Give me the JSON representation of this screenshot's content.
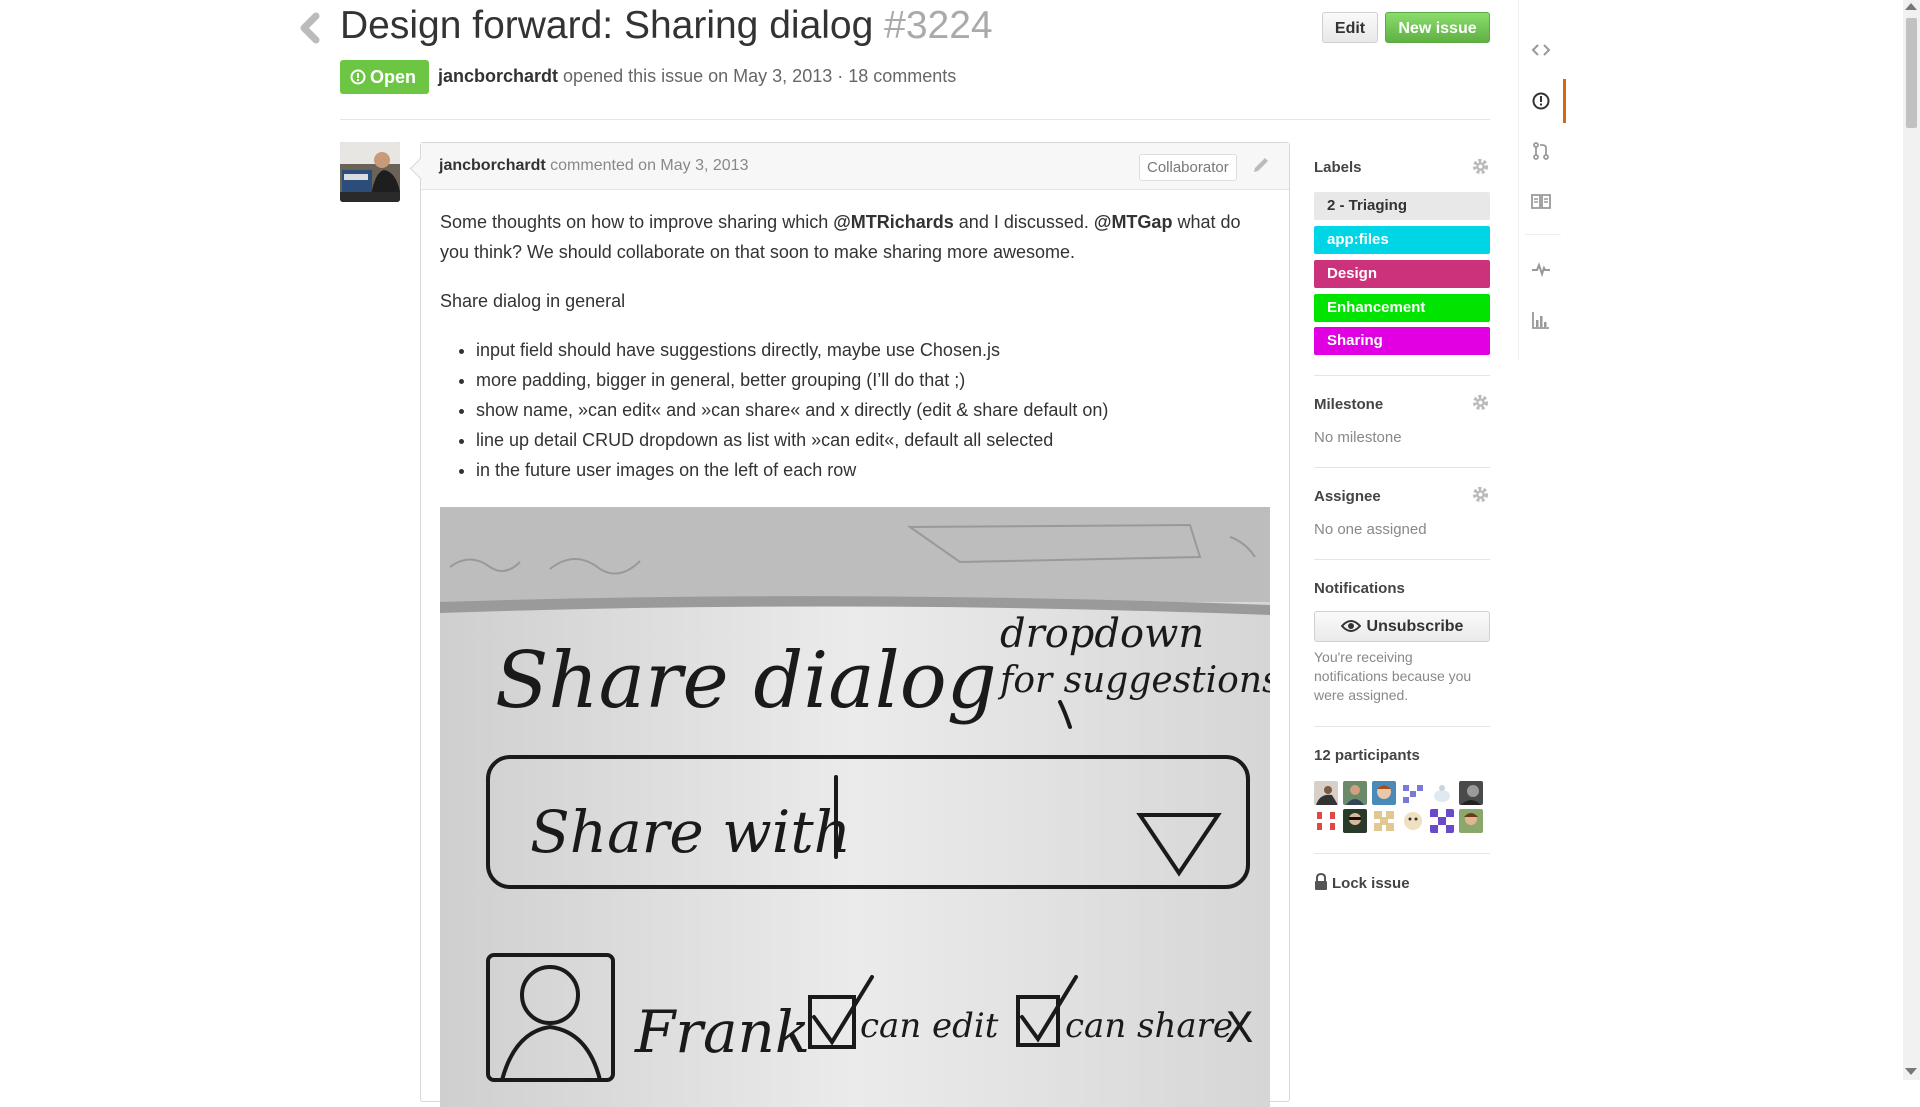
{
  "issue": {
    "title": "Design forward: Sharing dialog",
    "number": "#3224",
    "state": "Open",
    "author": "jancborchardt",
    "opened_text": "opened this issue on May 3, 2013 · 18 comments"
  },
  "header_actions": {
    "edit_label": "Edit",
    "new_issue_label": "New issue",
    "back_icon": "chevron-left-icon"
  },
  "comment": {
    "author": "jancborchardt",
    "commented_text": "commented on May 3, 2013",
    "role_badge": "Collaborator",
    "intro_part1": "Some thoughts on how to improve sharing which ",
    "mention1": "@MTRichards",
    "intro_part2": " and I discussed. ",
    "mention2": "@MTGap",
    "intro_part3": " what do you think? We should collaborate on that soon to make sharing more awesome.",
    "subheading": "Share dialog in general",
    "bullets": [
      "input field should have suggestions directly, maybe use Chosen.js",
      "more padding, bigger in general, better grouping (I’ll do that ;)",
      "show name, »can edit« and »can share« and x directly (edit & share default on)",
      "line up detail CRUD dropdown as list with »can edit«, default all selected",
      "in the future user images on the left of each row"
    ],
    "sketch": {
      "title": "Share dialog",
      "note_line1": "dropdown",
      "note_line2": "for suggestions",
      "input_text": "Share with",
      "user_name": "Frank",
      "can_edit": "can edit",
      "can_share": "can share",
      "remove_mark": "X"
    }
  },
  "sidebar": {
    "labels_heading": "Labels",
    "labels": [
      {
        "name": "2 - Triaging",
        "bg": "#e8e8e8",
        "fg": "#333333"
      },
      {
        "name": "app:files",
        "bg": "#00d5e6",
        "fg": "#ffffff"
      },
      {
        "name": "Design",
        "bg": "#cc317c",
        "fg": "#ffffff"
      },
      {
        "name": "Enhancement",
        "bg": "#00e400",
        "fg": "#ffffff"
      },
      {
        "name": "Sharing",
        "bg": "#e100e1",
        "fg": "#ffffff"
      }
    ],
    "milestone_heading": "Milestone",
    "milestone_value": "No milestone",
    "assignee_heading": "Assignee",
    "assignee_value": "No one assigned",
    "notifications_heading": "Notifications",
    "unsubscribe_label": "Unsubscribe",
    "notifications_reason": "You're receiving notifications because you were assigned.",
    "participants_heading": "12 participants",
    "participants": 12,
    "lock_label": "Lock issue"
  },
  "repo_nav": [
    {
      "name": "code",
      "icon": "code-icon"
    },
    {
      "name": "issues",
      "icon": "issue-opened-icon",
      "selected": true
    },
    {
      "name": "pull-requests",
      "icon": "pull-request-icon"
    },
    {
      "name": "wiki",
      "icon": "book-icon"
    },
    {
      "name": "pulse",
      "icon": "pulse-icon"
    },
    {
      "name": "graphs",
      "icon": "graph-icon"
    }
  ],
  "colors": {
    "open_green": "#6cc644",
    "new_issue_green": "#60b044",
    "nav_selected": "#d26911"
  }
}
